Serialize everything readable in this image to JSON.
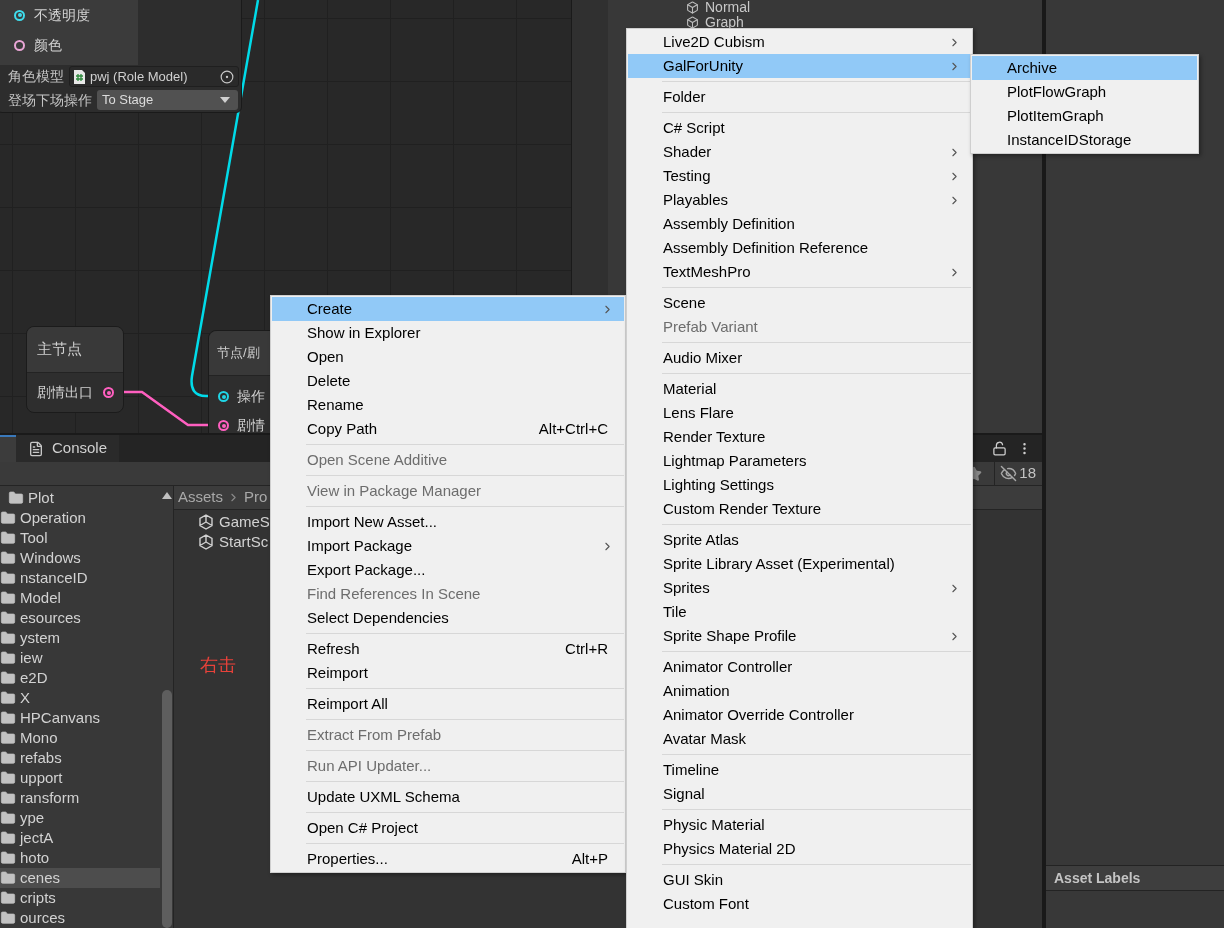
{
  "graph": {
    "top_node": {
      "ports": [
        {
          "label": "不透明度",
          "color": "#3fdcec",
          "connected": true
        },
        {
          "label": "颜色",
          "color": "#e9a6d6",
          "connected": false
        }
      ],
      "fields": [
        {
          "kind": "object",
          "label": "角色模型",
          "value": "pwj (Role Model)"
        },
        {
          "kind": "dropdown",
          "label": "登场下场操作",
          "value": "To Stage"
        }
      ]
    },
    "main_node": {
      "title": "主节点",
      "ports": [
        {
          "label": "剧情出口",
          "color": "#ff5fc0",
          "connected": true
        }
      ]
    },
    "plot_node": {
      "title": "节点/剧",
      "ports": [
        {
          "label": "操作",
          "color": "#20d6e6",
          "connected": true
        },
        {
          "label": "剧情",
          "color": "#ff5fc0",
          "connected": true
        }
      ]
    }
  },
  "hierarchy": {
    "items": [
      "Normal",
      "Graph"
    ]
  },
  "bottom_panel": {
    "tabs": [
      {
        "selected": true
      },
      {
        "label": "Console",
        "selected": false
      }
    ],
    "hidden_count": "18",
    "breadcrumb": [
      "Assets",
      "Pro"
    ],
    "folders": [
      {
        "children": [
          {
            "children": [
              {
                "label": "Plot",
                "selected": false
              }
            ]
          },
          {
            "label": "Operation",
            "selected": false
          },
          {
            "label": "Tool",
            "selected": false
          },
          {
            "label": "Windows",
            "selected": false
          }
        ]
      },
      {
        "label": "nstanceID",
        "selected": false
      },
      {
        "label": "Model",
        "selected": false
      },
      {
        "label": "esources",
        "selected": false
      },
      {
        "label": "ystem",
        "selected": false
      },
      {
        "label": "iew",
        "selected": false
      },
      {
        "label": "e2D",
        "selected": false
      },
      {
        "label": "X",
        "selected": false
      },
      {
        "label": "HPCanvans",
        "selected": false
      },
      {
        "label": "Mono",
        "selected": false
      },
      {
        "label": "refabs",
        "selected": false
      },
      {
        "label": "upport",
        "selected": false
      },
      {
        "label": "ransform",
        "selected": false
      },
      {
        "label": "ype",
        "selected": false
      },
      {
        "label": "jectA",
        "selected": false
      },
      {
        "label": "hoto",
        "selected": false
      },
      {
        "label": "cenes",
        "selected": true
      },
      {
        "label": "cripts",
        "selected": false
      },
      {
        "label": "ources",
        "selected": false
      }
    ],
    "files": [
      "GameS",
      "StartSc"
    ],
    "annotation": "右击"
  },
  "inspector": {
    "asset_labels": "Asset Labels"
  },
  "context_menu": {
    "items": [
      {
        "kind": "item",
        "label": "Create",
        "selected": true,
        "disabled": false,
        "submenu": true
      },
      {
        "kind": "item",
        "label": "Show in Explorer",
        "selected": false,
        "disabled": false,
        "submenu": false
      },
      {
        "kind": "item",
        "label": "Open",
        "selected": false,
        "disabled": false,
        "submenu": false
      },
      {
        "kind": "item",
        "label": "Delete",
        "selected": false,
        "disabled": false,
        "submenu": false
      },
      {
        "kind": "item",
        "label": "Rename",
        "selected": false,
        "disabled": false,
        "submenu": false
      },
      {
        "kind": "item",
        "label": "Copy Path",
        "shortcut": "Alt+Ctrl+C",
        "selected": false,
        "disabled": false,
        "submenu": false
      },
      {
        "kind": "separator"
      },
      {
        "kind": "item",
        "label": "Open Scene Additive",
        "selected": false,
        "disabled": true,
        "submenu": false
      },
      {
        "kind": "separator"
      },
      {
        "kind": "item",
        "label": "View in Package Manager",
        "selected": false,
        "disabled": true,
        "submenu": false
      },
      {
        "kind": "separator"
      },
      {
        "kind": "item",
        "label": "Import New Asset...",
        "selected": false,
        "disabled": false,
        "submenu": false
      },
      {
        "kind": "item",
        "label": "Import Package",
        "selected": false,
        "disabled": false,
        "submenu": true
      },
      {
        "kind": "item",
        "label": "Export Package...",
        "selected": false,
        "disabled": false,
        "submenu": false
      },
      {
        "kind": "item",
        "label": "Find References In Scene",
        "selected": false,
        "disabled": true,
        "submenu": false
      },
      {
        "kind": "item",
        "label": "Select Dependencies",
        "selected": false,
        "disabled": false,
        "submenu": false
      },
      {
        "kind": "separator"
      },
      {
        "kind": "item",
        "label": "Refresh",
        "shortcut": "Ctrl+R",
        "selected": false,
        "disabled": false,
        "submenu": false
      },
      {
        "kind": "item",
        "label": "Reimport",
        "selected": false,
        "disabled": false,
        "submenu": false
      },
      {
        "kind": "separator"
      },
      {
        "kind": "item",
        "label": "Reimport All",
        "selected": false,
        "disabled": false,
        "submenu": false
      },
      {
        "kind": "separator"
      },
      {
        "kind": "item",
        "label": "Extract From Prefab",
        "selected": false,
        "disabled": true,
        "submenu": false
      },
      {
        "kind": "separator"
      },
      {
        "kind": "item",
        "label": "Run API Updater...",
        "selected": false,
        "disabled": true,
        "submenu": false
      },
      {
        "kind": "separator"
      },
      {
        "kind": "item",
        "label": "Update UXML Schema",
        "selected": false,
        "disabled": false,
        "submenu": false
      },
      {
        "kind": "separator"
      },
      {
        "kind": "item",
        "label": "Open C# Project",
        "selected": false,
        "disabled": false,
        "submenu": false
      },
      {
        "kind": "separator"
      },
      {
        "kind": "item",
        "label": "Properties...",
        "shortcut": "Alt+P",
        "selected": false,
        "disabled": false,
        "submenu": false
      }
    ]
  },
  "create_submenu": {
    "items": [
      {
        "kind": "item",
        "label": "Live2D Cubism",
        "selected": false,
        "disabled": false,
        "submenu": true
      },
      {
        "kind": "item",
        "label": "GalForUnity",
        "selected": true,
        "disabled": false,
        "submenu": true
      },
      {
        "kind": "separator"
      },
      {
        "kind": "item",
        "label": "Folder",
        "selected": false,
        "disabled": false,
        "submenu": false
      },
      {
        "kind": "separator"
      },
      {
        "kind": "item",
        "label": "C# Script",
        "selected": false,
        "disabled": false,
        "submenu": false
      },
      {
        "kind": "item",
        "label": "Shader",
        "selected": false,
        "disabled": false,
        "submenu": true
      },
      {
        "kind": "item",
        "label": "Testing",
        "selected": false,
        "disabled": false,
        "submenu": true
      },
      {
        "kind": "item",
        "label": "Playables",
        "selected": false,
        "disabled": false,
        "submenu": true
      },
      {
        "kind": "item",
        "label": "Assembly Definition",
        "selected": false,
        "disabled": false,
        "submenu": false
      },
      {
        "kind": "item",
        "label": "Assembly Definition Reference",
        "selected": false,
        "disabled": false,
        "submenu": false
      },
      {
        "kind": "item",
        "label": "TextMeshPro",
        "selected": false,
        "disabled": false,
        "submenu": true
      },
      {
        "kind": "separator"
      },
      {
        "kind": "item",
        "label": "Scene",
        "selected": false,
        "disabled": false,
        "submenu": false
      },
      {
        "kind": "item",
        "label": "Prefab Variant",
        "selected": false,
        "disabled": true,
        "submenu": false
      },
      {
        "kind": "separator"
      },
      {
        "kind": "item",
        "label": "Audio Mixer",
        "selected": false,
        "disabled": false,
        "submenu": false
      },
      {
        "kind": "separator"
      },
      {
        "kind": "item",
        "label": "Material",
        "selected": false,
        "disabled": false,
        "submenu": false
      },
      {
        "kind": "item",
        "label": "Lens Flare",
        "selected": false,
        "disabled": false,
        "submenu": false
      },
      {
        "kind": "item",
        "label": "Render Texture",
        "selected": false,
        "disabled": false,
        "submenu": false
      },
      {
        "kind": "item",
        "label": "Lightmap Parameters",
        "selected": false,
        "disabled": false,
        "submenu": false
      },
      {
        "kind": "item",
        "label": "Lighting Settings",
        "selected": false,
        "disabled": false,
        "submenu": false
      },
      {
        "kind": "item",
        "label": "Custom Render Texture",
        "selected": false,
        "disabled": false,
        "submenu": false
      },
      {
        "kind": "separator"
      },
      {
        "kind": "item",
        "label": "Sprite Atlas",
        "selected": false,
        "disabled": false,
        "submenu": false
      },
      {
        "kind": "item",
        "label": "Sprite Library Asset (Experimental)",
        "selected": false,
        "disabled": false,
        "submenu": false
      },
      {
        "kind": "item",
        "label": "Sprites",
        "selected": false,
        "disabled": false,
        "submenu": true
      },
      {
        "kind": "item",
        "label": "Tile",
        "selected": false,
        "disabled": false,
        "submenu": false
      },
      {
        "kind": "item",
        "label": "Sprite Shape Profile",
        "selected": false,
        "disabled": false,
        "submenu": true
      },
      {
        "kind": "separator"
      },
      {
        "kind": "item",
        "label": "Animator Controller",
        "selected": false,
        "disabled": false,
        "submenu": false
      },
      {
        "kind": "item",
        "label": "Animation",
        "selected": false,
        "disabled": false,
        "submenu": false
      },
      {
        "kind": "item",
        "label": "Animator Override Controller",
        "selected": false,
        "disabled": false,
        "submenu": false
      },
      {
        "kind": "item",
        "label": "Avatar Mask",
        "selected": false,
        "disabled": false,
        "submenu": false
      },
      {
        "kind": "separator"
      },
      {
        "kind": "item",
        "label": "Timeline",
        "selected": false,
        "disabled": false,
        "submenu": false
      },
      {
        "kind": "item",
        "label": "Signal",
        "selected": false,
        "disabled": false,
        "submenu": false
      },
      {
        "kind": "separator"
      },
      {
        "kind": "item",
        "label": "Physic Material",
        "selected": false,
        "disabled": false,
        "submenu": false
      },
      {
        "kind": "item",
        "label": "Physics Material 2D",
        "selected": false,
        "disabled": false,
        "submenu": false
      },
      {
        "kind": "separator"
      },
      {
        "kind": "item",
        "label": "GUI Skin",
        "selected": false,
        "disabled": false,
        "submenu": false
      },
      {
        "kind": "item",
        "label": "Custom Font",
        "selected": false,
        "disabled": false,
        "submenu": false
      }
    ]
  },
  "galforunity_submenu": {
    "items": [
      {
        "kind": "item",
        "label": "Archive",
        "selected": true,
        "disabled": false,
        "submenu": false
      },
      {
        "kind": "item",
        "label": "PlotFlowGraph",
        "selected": false,
        "disabled": false,
        "submenu": false
      },
      {
        "kind": "item",
        "label": "PlotItemGraph",
        "selected": false,
        "disabled": false,
        "submenu": false
      },
      {
        "kind": "item",
        "label": "InstanceIDStorage",
        "selected": false,
        "disabled": false,
        "submenu": false
      }
    ]
  }
}
